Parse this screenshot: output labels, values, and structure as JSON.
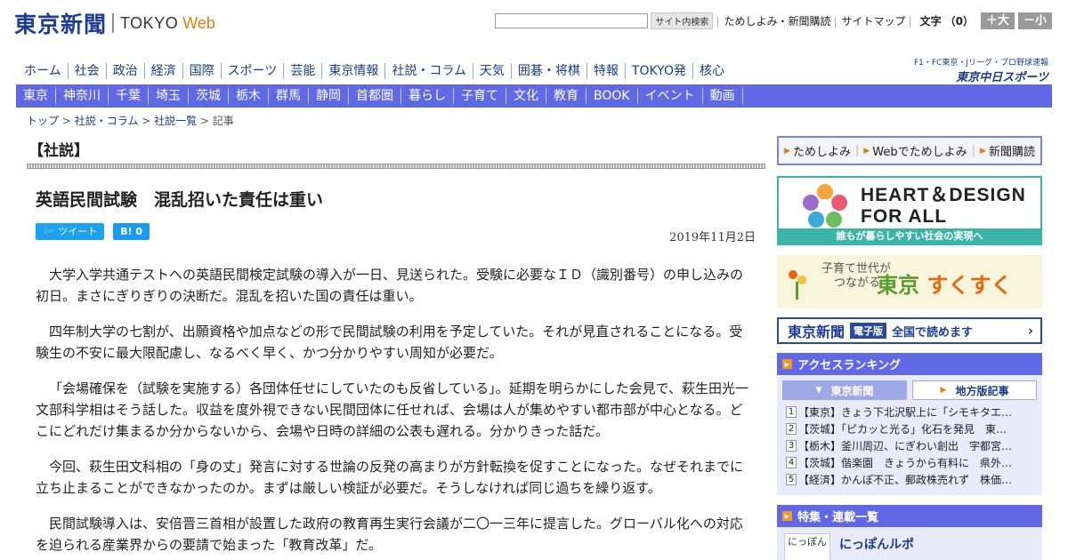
{
  "header": {
    "logo_jp": "東京新聞",
    "logo_tokyo": "TOKYO",
    "logo_web": "Web",
    "search_button": "サイト内検索",
    "links": [
      "ためしよみ・新聞購読",
      "サイトマップ"
    ],
    "font_label": "文字",
    "font_size_value": "（0）",
    "font_increase": "＋大",
    "font_decrease": "－小"
  },
  "main_nav": [
    "ホーム",
    "社会",
    "政治",
    "経済",
    "国際",
    "スポーツ",
    "芸能",
    "東京情報",
    "社説・コラム",
    "天気",
    "囲碁・将棋",
    "特報",
    "TOKYO発",
    "核心"
  ],
  "sports_logo": {
    "top": "F1・FC東京・Jリーグ・プロ野球速報",
    "main": "東京中日スポーツ"
  },
  "region_nav": [
    "東京",
    "神奈川",
    "千葉",
    "埼玉",
    "茨城",
    "栃木",
    "群馬",
    "静岡",
    "首都圏",
    "暮らし",
    "子育て",
    "文化",
    "教育",
    "BOOK",
    "イベント",
    "動画"
  ],
  "breadcrumb": {
    "items": [
      "トップ",
      "社説・コラム",
      "社説一覧"
    ],
    "current": "記事"
  },
  "article": {
    "section": "【社説】",
    "headline": "英語民間試験　混乱招いた責任は重い",
    "tweet_label": "ツイート",
    "hatena_label": "B! 0",
    "date": "2019年11月2日",
    "paragraphs": [
      "大学入学共通テストへの英語民間検定試験の導入が一日、見送られた。受験に必要なＩＤ（識別番号）の申し込みの初日。まさにぎりぎりの決断だ。混乱を招いた国の責任は重い。",
      "四年制大学の七割が、出願資格や加点などの形で民間試験の利用を予定していた。それが見直されることになる。受験生の不安に最大限配慮し、なるべく早く、かつ分かりやすい周知が必要だ。",
      "「会場確保を（試験を実施する）各団体任せにしていたのも反省している」。延期を明らかにした会見で、萩生田光一文部科学相はそう話した。収益を度外視できない民間団体に任せれば、会場は人が集めやすい都市部が中心となる。どこにどれだけ集まるか分からないから、会場や日時の詳細の公表も遅れる。分かりきった話だ。",
      "今回、萩生田文科相の「身の丈」発言に対する世論の反発の高まりが方針転換を促すことになった。なぜそれまでに立ち止まることができなかったのか。まずは厳しい検証が必要だ。そうしなければ同じ過ちを繰り返す。",
      "民間試験導入は、安倍晋三首相が設置した政府の教育再生実行会議が二〇一三年に提言した。グローバル化への対応を迫られる産業界からの要請で始まった「教育改革」だ。"
    ]
  },
  "sidebar": {
    "links": [
      "ためしよみ",
      "Webでためしよみ",
      "新聞購読"
    ],
    "heart_title_1": "HEART＆DESIGN",
    "heart_title_2": "FOR ALL",
    "heart_sub": "誰もが暮らしやすい社会の実現へ",
    "suku_small_1": "子育て世代が",
    "suku_small_2": "つながる",
    "suku_big_1": "東京",
    "suku_big_2": "すくすく",
    "epaper_logo": "東京新聞",
    "epaper_badge": "電子版",
    "epaper_text": "全国で読めます",
    "ranking_title": "アクセスランキング",
    "ranking_tabs": [
      "東京新聞",
      "地方版記事"
    ],
    "ranking": [
      {
        "num": "1",
        "text": "【東京】きょう下北沢駅上に「シモキタエ…"
      },
      {
        "num": "2",
        "text": "【茨城】「ピカッと光る」化石を発見　東…"
      },
      {
        "num": "3",
        "text": "【栃木】釜川周辺、にぎわい創出　宇都宮…"
      },
      {
        "num": "4",
        "text": "【茨城】偕楽園　きょうから有料に　県外…"
      },
      {
        "num": "5",
        "text": "【経済】かんぽ不正、郵政株売れず　株価…"
      }
    ],
    "feature_title": "特集・連載一覧",
    "feature_thumb": "にっぽん",
    "feature_item": "にっぽんルポ"
  },
  "colors": {
    "brand_blue": "#1e3d9a",
    "nav_purple": "#6168e6",
    "accent_orange": "#e37c10",
    "heart_teal": "#3cb4a8"
  }
}
